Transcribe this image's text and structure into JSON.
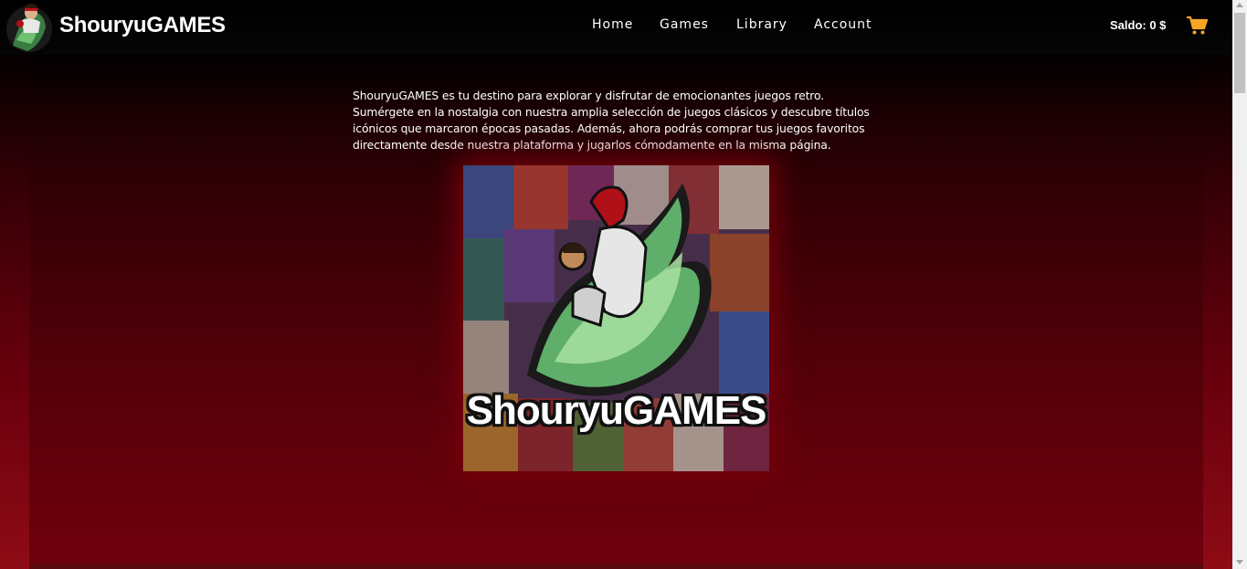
{
  "header": {
    "brand": "ShouryuGAMES",
    "logo_icon": "fighter-avatar-icon",
    "nav": [
      {
        "label": "Home"
      },
      {
        "label": "Games"
      },
      {
        "label": "Library"
      },
      {
        "label": "Account"
      }
    ],
    "balance": "Saldo: 0 $",
    "cart_icon": "shopping-cart-icon",
    "cart_color": "#f5a623"
  },
  "main": {
    "intro": "ShouryuGAMES es tu destino para explorar y disfrutar de emocionantes juegos retro. Sumérgete en la nostalgia con nuestra amplia selección de juegos clásicos y descubre títulos icónicos que marcaron épocas pasadas. Además, ahora podrás comprar tus juegos favoritos directamente desde nuestra plataforma y jugarlos cómodamente en la misma página.",
    "hero": {
      "logo_text": "ShouryuGAMES",
      "description_icon": "fighter-collage-logo-image"
    }
  },
  "theme": {
    "accent_dark": "#70000e",
    "accent_bright": "#8f0c16"
  }
}
